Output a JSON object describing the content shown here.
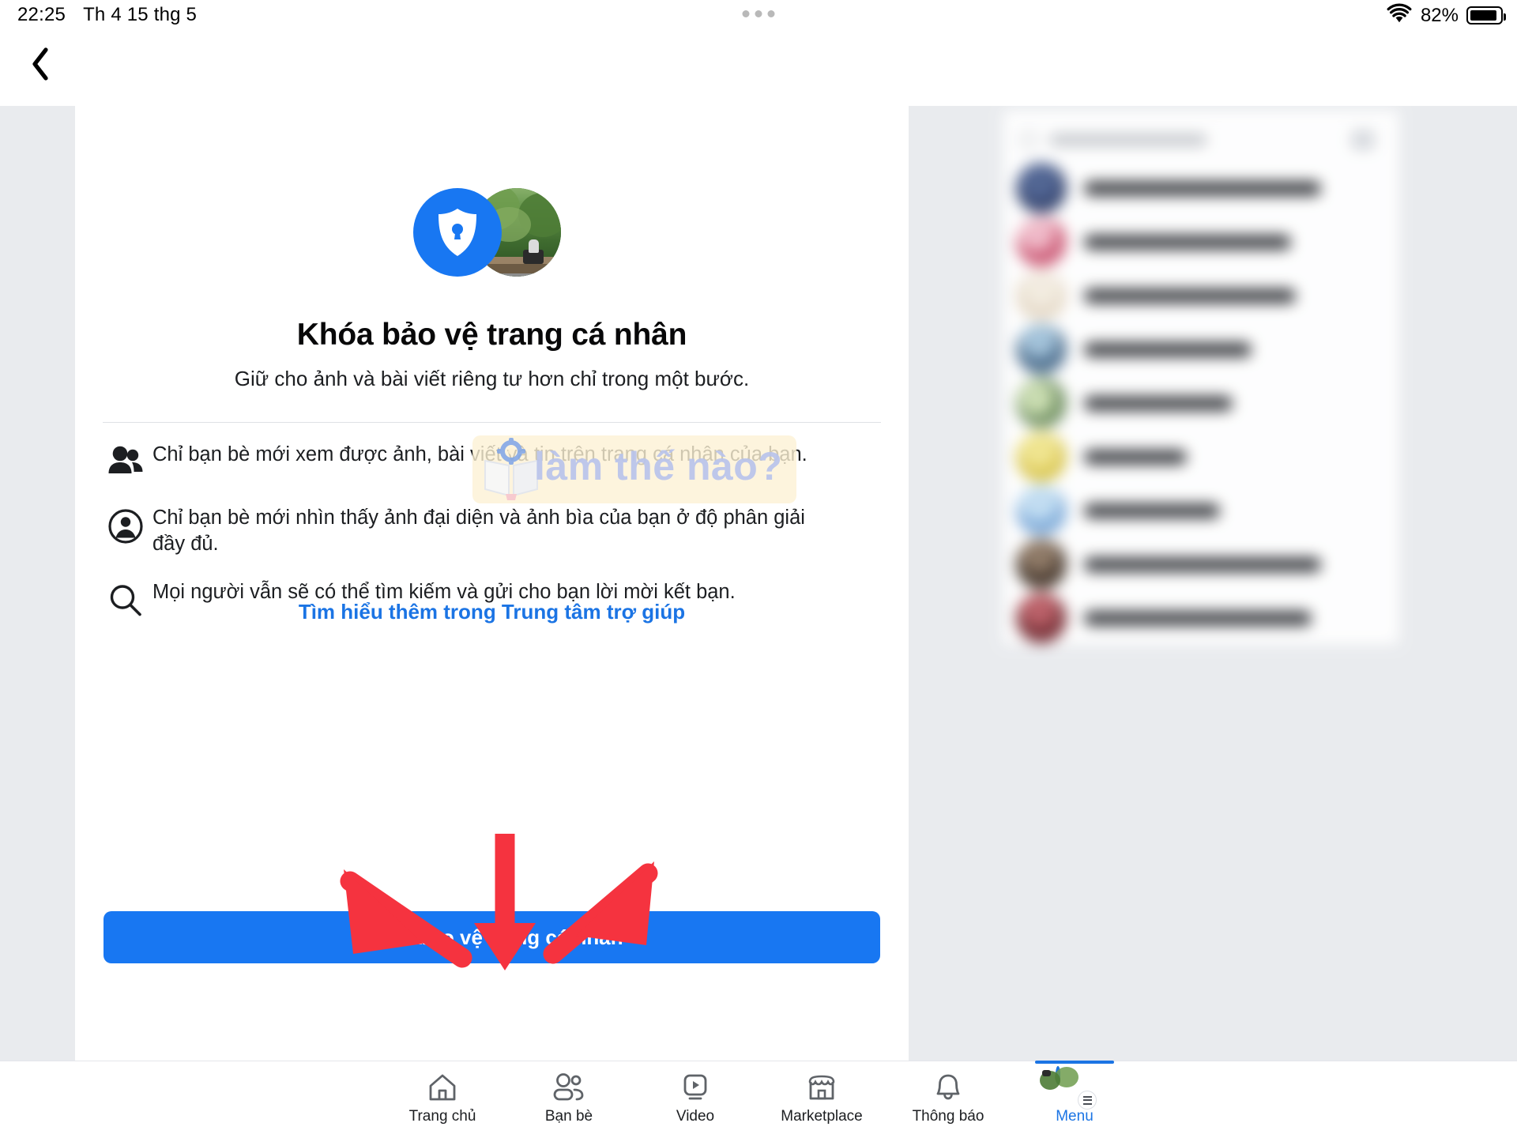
{
  "status_bar": {
    "time": "22:25",
    "date": "Th 4 15 thg 5",
    "battery_percent": "82%",
    "wifi_icon": "wifi-icon",
    "battery_icon": "battery-icon",
    "dots_icon": "three-dots-icon"
  },
  "navigation": {
    "back_icon": "chevron-left-icon"
  },
  "hero": {
    "shield_icon": "shield-lock-icon",
    "avatar_icon": "profile-avatar-photo"
  },
  "main": {
    "title": "Khóa bảo vệ trang cá nhân",
    "subtitle": "Giữ cho ảnh và bài viết riêng tư hơn chỉ trong một bước.",
    "bullets": [
      {
        "icon": "friends-icon",
        "text": "Chỉ bạn bè mới xem được ảnh, bài viết và tin trên trang cá nhân của bạn."
      },
      {
        "icon": "profile-circle-icon",
        "text": "Chỉ bạn bè mới nhìn thấy ảnh đại diện và ảnh bìa của bạn ở độ phân giải đầy đủ."
      },
      {
        "icon": "search-icon",
        "text": "Mọi người vẫn sẽ có thể tìm kiếm và gửi cho bạn lời mời kết bạn."
      }
    ],
    "help_link": "Tìm hiểu thêm trong Trung tâm trợ giúp",
    "cta_label": "Khóa bảo vệ trang cá nhân"
  },
  "watermark": {
    "text": "làm thế nào?",
    "logo_icon": "book-gear-icon",
    "plate_color": "#fdf1d4",
    "text_color": "#b9c4ec"
  },
  "annotations": {
    "arrow_color": "#f5333f",
    "arrow_count": 3,
    "target": "cta-button"
  },
  "side_panel": {
    "blurred": true,
    "search_placeholder": "",
    "search_icon": "search-icon",
    "compose_icon": "compose-icon",
    "rows": [
      {
        "name_width": 300,
        "avatar_color": "#2f3f6b"
      },
      {
        "name_width": 262,
        "avatar_color": "#cf5f7a"
      },
      {
        "name_width": 268,
        "avatar_color": "#e6d9c6"
      },
      {
        "name_width": 212,
        "avatar_color": "#4d6f8f"
      },
      {
        "name_width": 188,
        "avatar_color": "#6f8f5f"
      },
      {
        "name_width": 130,
        "avatar_color": "#d8c44a"
      },
      {
        "name_width": 172,
        "avatar_color": "#7aa8d8"
      },
      {
        "name_width": 300,
        "avatar_color": "#4a3a2e"
      },
      {
        "name_width": 288,
        "avatar_color": "#7a2f36"
      }
    ]
  },
  "tab_bar": {
    "items": [
      {
        "label": "Trang chủ",
        "icon": "home-icon",
        "active": false
      },
      {
        "label": "Bạn bè",
        "icon": "friends-icon",
        "active": false
      },
      {
        "label": "Video",
        "icon": "video-icon",
        "active": false
      },
      {
        "label": "Marketplace",
        "icon": "marketplace-icon",
        "active": false
      },
      {
        "label": "Thông báo",
        "icon": "bell-icon",
        "active": false
      },
      {
        "label": "Menu",
        "icon": "menu-avatar-icon",
        "active": true
      }
    ],
    "active_color": "#1b74e4"
  },
  "colors": {
    "accent": "#1877f2",
    "link": "#1b74e4",
    "text": "#1c1e21",
    "canvas": "#e9ebee",
    "card": "#ffffff",
    "arrow_red": "#f5333f"
  }
}
